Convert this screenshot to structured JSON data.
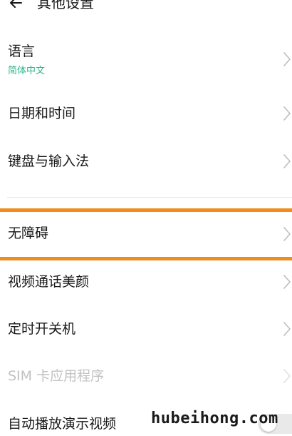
{
  "header": {
    "title": "其他设置",
    "back_icon": "back-arrow-icon"
  },
  "rows": [
    {
      "label": "语言",
      "sub": "简体中文",
      "icon": "chevron-right-icon"
    },
    {
      "label": "日期和时间",
      "icon": "chevron-right-icon"
    },
    {
      "label": "键盘与输入法",
      "icon": "chevron-right-icon"
    },
    {
      "label": "无障碍",
      "icon": "chevron-right-icon",
      "highlighted": true
    },
    {
      "label": "视频通话美颜",
      "icon": "chevron-right-icon"
    },
    {
      "label": "定时开关机",
      "icon": "chevron-right-icon"
    },
    {
      "label": "SIM 卡应用程序",
      "icon": "chevron-right-icon",
      "disabled": true
    },
    {
      "label": "自动播放演示视频",
      "icon": "toggle-switch"
    }
  ],
  "watermark": "hubeihong.com",
  "colors": {
    "accent_green": "#2bb38a",
    "highlight_orange": "#f08c1e",
    "disabled_text": "#c2c2c2",
    "chevron": "#bdbdbd"
  }
}
